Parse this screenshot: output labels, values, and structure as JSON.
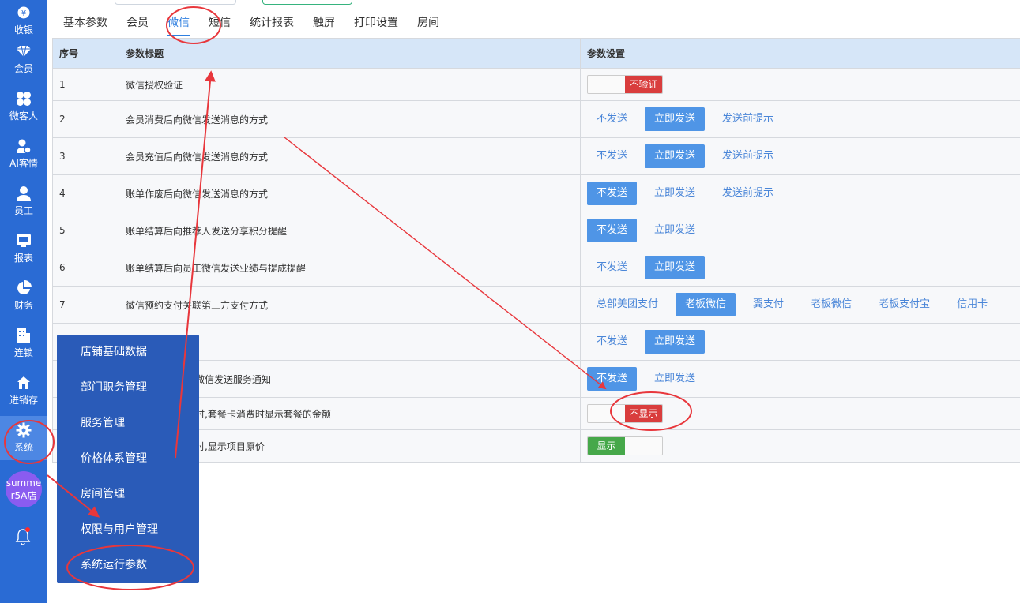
{
  "sidebar": {
    "items": [
      {
        "label": "收银",
        "icon": "yen-icon"
      },
      {
        "label": "会员",
        "icon": "diamond-icon"
      },
      {
        "label": "微客人",
        "icon": "clover-icon"
      },
      {
        "label": "AI客情",
        "icon": "ai-user-icon"
      },
      {
        "label": "员工",
        "icon": "person-icon"
      },
      {
        "label": "报表",
        "icon": "monitor-icon"
      },
      {
        "label": "财务",
        "icon": "pie-icon"
      },
      {
        "label": "连锁",
        "icon": "building-icon"
      },
      {
        "label": "进销存",
        "icon": "home-icon"
      },
      {
        "label": "系统",
        "icon": "gear-icon"
      }
    ],
    "avatar_text": "summer5A店",
    "accent": "#2a6bd4"
  },
  "tabs": [
    {
      "label": "基本参数"
    },
    {
      "label": "会员"
    },
    {
      "label": "微信"
    },
    {
      "label": "短信"
    },
    {
      "label": "统计报表"
    },
    {
      "label": "触屏"
    },
    {
      "label": "打印设置"
    },
    {
      "label": "房间"
    }
  ],
  "table": {
    "headers": [
      "序号",
      "参数标题",
      "参数设置"
    ],
    "rows": [
      {
        "no": "1",
        "title": "微信授权验证"
      },
      {
        "no": "2",
        "title": "会员消费后向微信发送消息的方式",
        "options": [
          "不发送",
          "立即发送",
          "发送前提示"
        ]
      },
      {
        "no": "3",
        "title": "会员充值后向微信发送消息的方式",
        "options": [
          "不发送",
          "立即发送",
          "发送前提示"
        ]
      },
      {
        "no": "4",
        "title": "账单作废后向微信发送消息的方式",
        "options": [
          "不发送",
          "立即发送",
          "发送前提示"
        ]
      },
      {
        "no": "5",
        "title": "账单结算后向推荐人发送分享积分提醒",
        "options": [
          "不发送",
          "立即发送"
        ]
      },
      {
        "no": "6",
        "title": "账单结算后向员工微信发送业绩与提成提醒",
        "options": [
          "不发送",
          "立即发送"
        ]
      },
      {
        "no": "7",
        "title": "微信预约支付关联第三方支付方式",
        "options": [
          "总部美团支付",
          "老板微信",
          "翼支付",
          "老板微信",
          "老板支付宝",
          "信用卡"
        ]
      },
      {
        "no": "",
        "title": "",
        "options": [
          "不发送",
          "立即发送"
        ]
      },
      {
        "no": "",
        "title": "微信发送服务通知",
        "options": [
          "不发送",
          "立即发送"
        ]
      },
      {
        "no": "",
        "title": "时,套餐卡消费时显示套餐的金额"
      },
      {
        "no": "",
        "title": "时,显示项目原价"
      }
    ],
    "switch_labels": {
      "not_verify": "不验证",
      "not_show": "不显示",
      "show": "显示"
    }
  },
  "menu": {
    "items": [
      "店铺基础数据",
      "部门职务管理",
      "服务管理",
      "价格体系管理",
      "房间管理",
      "权限与用户管理",
      "系统运行参数"
    ]
  },
  "colors": {
    "selected_option": "#4f95e6",
    "switch_off": "#d93d3d",
    "switch_on": "#46a84a",
    "annotation": "#e8373c"
  }
}
